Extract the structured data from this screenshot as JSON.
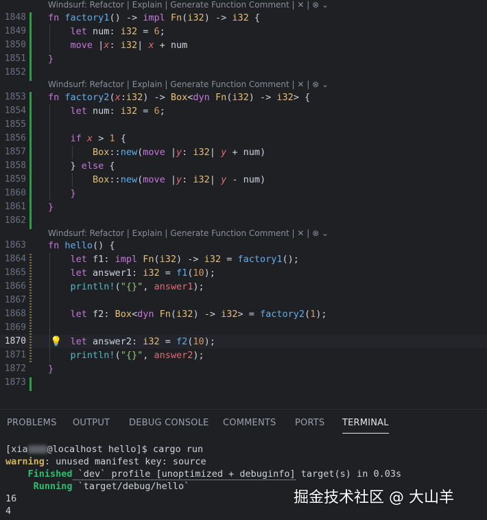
{
  "editor": {
    "lens1": "Windsurf: Refactor | Explain | Generate Function Comment | ✕ | ⊗ ⌄",
    "lens2": "Windsurf: Refactor | Explain | Generate Function Comment | ✕ | ⊗ ⌄",
    "lens3": "Windsurf: Refactor | Explain | Generate Function Comment | ✕ | ⊗ ⌄",
    "line_numbers": [
      "1848",
      "1849",
      "1850",
      "1851",
      "1852",
      "1853",
      "1854",
      "1855",
      "1856",
      "1857",
      "1858",
      "1859",
      "1860",
      "1861",
      "1862",
      "1863",
      "1864",
      "1865",
      "1866",
      "1867",
      "1868",
      "1869",
      "1870",
      "1871",
      "1872",
      "1873"
    ],
    "current_line": "1870"
  },
  "panel": {
    "tabs": [
      "PROBLEMS",
      "OUTPUT",
      "DEBUG CONSOLE",
      "COMMENTS",
      "PORTS",
      "TERMINAL"
    ],
    "active_tab": "TERMINAL"
  },
  "terminal": {
    "prompt_prefix": "[xia",
    "prompt_suffix": "@localhost hello]$ cargo run",
    "warning_label": "warning",
    "warning_text": ": unused manifest key: source",
    "finished_label": "Finished",
    "finished_text_a": " `dev` profile [unoptimized + debuginfo]",
    "finished_text_b": " target(s) in 0.03s",
    "running_label": "Running",
    "running_text": " `target/debug/hello`",
    "out1": "16",
    "out2": "4"
  },
  "watermark": "掘金技术社区 @ 大山羊",
  "colors": {
    "background": "#1f2024",
    "keyword": "#c678dd",
    "function": "#61afef",
    "type": "#e5c07b",
    "number": "#d19a66",
    "variable": "#e06c75",
    "added_bar": "#2ea043"
  }
}
